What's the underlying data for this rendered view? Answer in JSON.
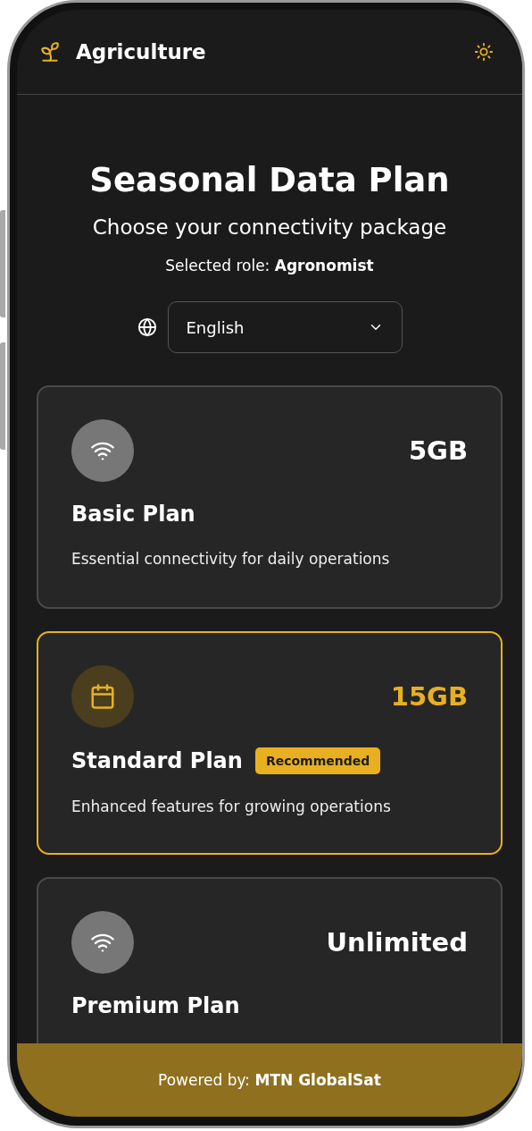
{
  "header": {
    "title": "Agriculture"
  },
  "intro": {
    "title": "Seasonal Data Plan",
    "subtitle": "Choose your connectivity package",
    "role_label": "Selected role:",
    "role": "Agronomist"
  },
  "language": {
    "value": "English"
  },
  "plans": [
    {
      "kind": "wifi",
      "amount": "5GB",
      "name": "Basic Plan",
      "description": "Essential connectivity for daily operations",
      "selected": false
    },
    {
      "kind": "calendar",
      "amount": "15GB",
      "name": "Standard Plan",
      "badge": "Recommended",
      "description": "Enhanced features for growing operations",
      "selected": true
    },
    {
      "kind": "wifi",
      "amount": "Unlimited",
      "name": "Premium Plan",
      "selected": false
    }
  ],
  "footer": {
    "label": "Powered by:",
    "provider": "MTN GlobalSat"
  }
}
